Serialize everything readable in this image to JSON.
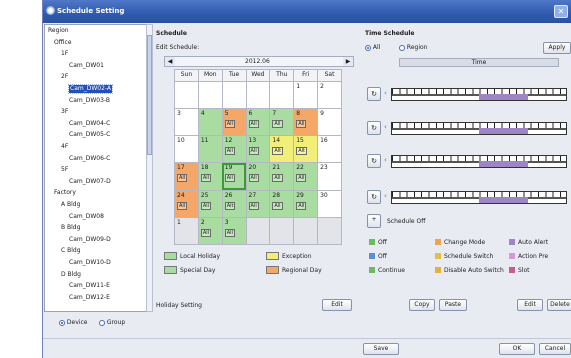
{
  "window": {
    "title": "Schedule Setting"
  },
  "tree": {
    "items": [
      {
        "label": "Region",
        "depth": 0
      },
      {
        "label": "Office",
        "depth": 1
      },
      {
        "label": "1F",
        "depth": 2
      },
      {
        "label": "Cam_DW01",
        "depth": 3
      },
      {
        "label": "2F",
        "depth": 2
      },
      {
        "label": "Cam_DW02-A",
        "depth": 3,
        "selected": true
      },
      {
        "label": "Cam_DW03-B",
        "depth": 3
      },
      {
        "label": "3F",
        "depth": 2
      },
      {
        "label": "Cam_DW04-C",
        "depth": 3
      },
      {
        "label": "Cam_DW05-C",
        "depth": 3
      },
      {
        "label": "4F",
        "depth": 2
      },
      {
        "label": "Cam_DW06-C",
        "depth": 3
      },
      {
        "label": "5F",
        "depth": 2
      },
      {
        "label": "Cam_DW07-D",
        "depth": 3
      },
      {
        "label": "Factory",
        "depth": 1
      },
      {
        "label": "A Bldg",
        "depth": 2
      },
      {
        "label": "Cam_DW08",
        "depth": 3
      },
      {
        "label": "B Bldg",
        "depth": 2
      },
      {
        "label": "Cam_DW09-D",
        "depth": 3
      },
      {
        "label": "C Bldg",
        "depth": 2
      },
      {
        "label": "Cam_DW10-D",
        "depth": 3
      },
      {
        "label": "D Bldg",
        "depth": 2
      },
      {
        "label": "Cam_DW11-E",
        "depth": 3
      },
      {
        "label": "Cam_DW12-E",
        "depth": 3
      }
    ],
    "footer": {
      "opt1": "Device",
      "opt2": "Group"
    }
  },
  "schedule": {
    "heading": "Schedule",
    "subheading": "Edit Schedule:",
    "month": "2012.06",
    "weekdays": [
      "Sun",
      "Mon",
      "Tue",
      "Wed",
      "Thu",
      "Fri",
      "Sat"
    ],
    "weeks": [
      [
        {
          "d": "",
          "c": "white"
        },
        {
          "d": "",
          "c": "white"
        },
        {
          "d": "",
          "c": "white"
        },
        {
          "d": "",
          "c": "white"
        },
        {
          "d": "",
          "c": "white"
        },
        {
          "d": "1",
          "c": "white"
        },
        {
          "d": "2",
          "c": "white"
        }
      ],
      [
        {
          "d": "3",
          "c": "white"
        },
        {
          "d": "4",
          "c": "green"
        },
        {
          "d": "5",
          "c": "orange",
          "t": "All"
        },
        {
          "d": "6",
          "c": "green",
          "t": "All"
        },
        {
          "d": "7",
          "c": "green",
          "t": "All"
        },
        {
          "d": "8",
          "c": "orange",
          "t": "All"
        },
        {
          "d": "9",
          "c": "white"
        }
      ],
      [
        {
          "d": "10",
          "c": "white"
        },
        {
          "d": "11",
          "c": "green"
        },
        {
          "d": "12",
          "c": "green",
          "t": "All"
        },
        {
          "d": "13",
          "c": "green",
          "t": "All"
        },
        {
          "d": "14",
          "c": "yellow",
          "t": "Alt"
        },
        {
          "d": "15",
          "c": "yellow",
          "t": "Alt"
        },
        {
          "d": "16",
          "c": "white"
        }
      ],
      [
        {
          "d": "17",
          "c": "orange",
          "t": "All"
        },
        {
          "d": "18",
          "c": "green",
          "t": "All"
        },
        {
          "d": "19",
          "c": "green",
          "t": "All",
          "today": true
        },
        {
          "d": "20",
          "c": "green",
          "t": "All"
        },
        {
          "d": "21",
          "c": "green",
          "t": "All"
        },
        {
          "d": "22",
          "c": "green",
          "t": "All"
        },
        {
          "d": "23",
          "c": "white"
        }
      ],
      [
        {
          "d": "24",
          "c": "orange",
          "t": "All"
        },
        {
          "d": "25",
          "c": "green",
          "t": "All"
        },
        {
          "d": "26",
          "c": "green",
          "t": "Alt"
        },
        {
          "d": "27",
          "c": "green",
          "t": "All"
        },
        {
          "d": "28",
          "c": "green",
          "t": "All"
        },
        {
          "d": "29",
          "c": "green",
          "t": "All"
        },
        {
          "d": "30",
          "c": "white"
        }
      ],
      [
        {
          "d": "1",
          "c": "gray"
        },
        {
          "d": "2",
          "c": "green",
          "t": "All"
        },
        {
          "d": "3",
          "c": "green",
          "t": "All"
        },
        {
          "d": "",
          "c": "gray"
        },
        {
          "d": "",
          "c": "gray"
        },
        {
          "d": "",
          "c": "gray"
        },
        {
          "d": "",
          "c": "gray"
        }
      ]
    ],
    "legend": {
      "item1": "Local Holiday",
      "item2": "Exception",
      "item3": "Special Day",
      "item4": "Regional Day"
    },
    "footer_note": "Holiday Setting",
    "edit_button": "Edit"
  },
  "time": {
    "heading": "Time Schedule",
    "opt_all": "All",
    "opt_region": "Region",
    "top_button": "Apply",
    "time_label": "Time",
    "tracks": [
      {
        "icon": "↻",
        "start": 0.5,
        "end": 0.78
      },
      {
        "icon": "↻",
        "start": 0.5,
        "end": 0.78
      },
      {
        "icon": "↻",
        "start": 0.5,
        "end": 0.78
      },
      {
        "icon": "↻",
        "start": 0.5,
        "end": 0.78
      }
    ],
    "add_label": "Schedule Off",
    "legend": [
      {
        "label": "Off",
        "color": "#6dbb5e"
      },
      {
        "label": "Change Mode",
        "color": "#f2a052"
      },
      {
        "label": "Auto Alert",
        "color": "#9e86c6"
      },
      {
        "label": "Off",
        "color": "#5c8ed3"
      },
      {
        "label": "Schedule Switch",
        "color": "#e0c040"
      },
      {
        "label": "Action Pre",
        "color": "#d49ad8"
      },
      {
        "label": "Continue",
        "color": "#6dbb5e"
      },
      {
        "label": "Disable Auto Switch",
        "color": "#e6ae3a"
      },
      {
        "label": "Slot",
        "color": "#cc5a8c"
      }
    ],
    "buttons": {
      "copy": "Copy",
      "paste": "Paste",
      "edit": "Edit",
      "delete": "Delete"
    }
  },
  "bottom": {
    "save": "Save",
    "ok": "OK",
    "cancel": "Cancel"
  }
}
